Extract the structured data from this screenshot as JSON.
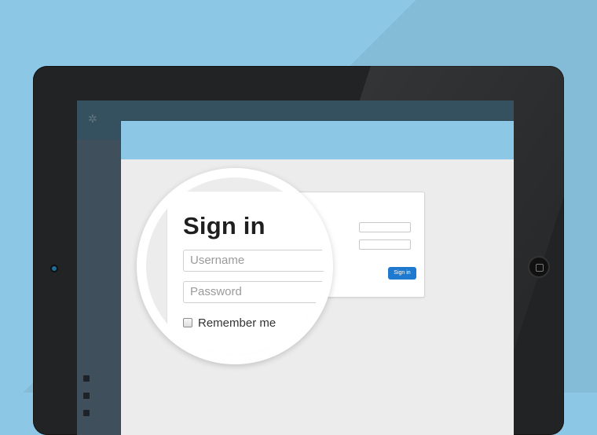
{
  "colors": {
    "background": "#8cc8e6",
    "device_frame": "#222325",
    "modal_header": "#8cc8e6",
    "modal_body": "#ececec",
    "primary_button": "#1e79cf"
  },
  "icons": {
    "close": "close-icon",
    "checkbox": "checkbox-icon"
  },
  "dialog": {
    "close_symbol": "×"
  },
  "small_form": {
    "signin_button": "Sign in"
  },
  "magnified_form": {
    "title": "Sign in",
    "username_placeholder": "Username",
    "password_placeholder": "Password",
    "remember_label": "Remember me"
  }
}
